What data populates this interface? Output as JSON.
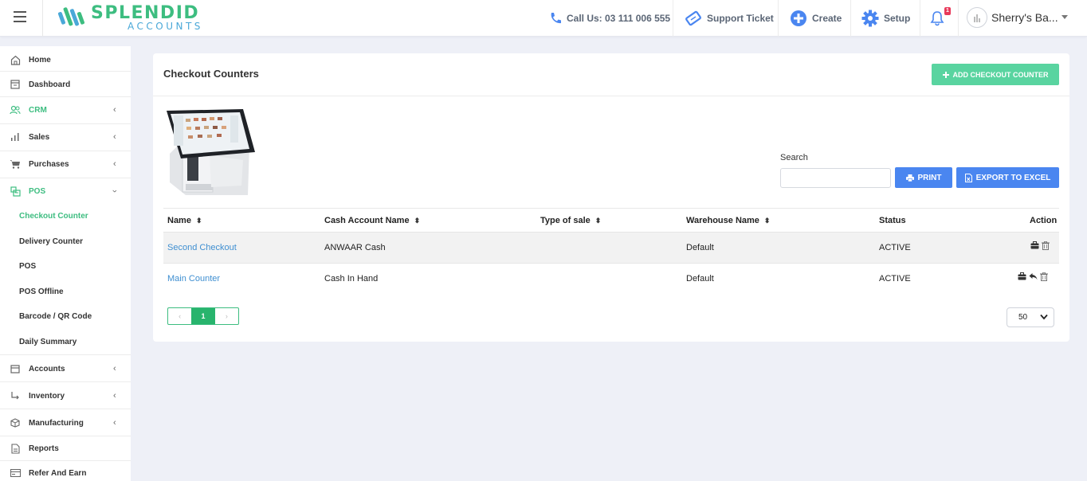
{
  "brand": {
    "name": "SPLENDID",
    "sub": "ACCOUNTS"
  },
  "header": {
    "call_label": "Call Us: 03 111 006 555",
    "support_label": "Support Ticket",
    "create_label": "Create",
    "setup_label": "Setup",
    "notification_count": "1",
    "user_name": "Sherry's Ba..."
  },
  "sidebar": {
    "items": [
      {
        "label": "Home",
        "icon": "home-icon"
      },
      {
        "label": "Dashboard",
        "icon": "dashboard-icon"
      },
      {
        "label": "CRM",
        "icon": "users-icon"
      },
      {
        "label": "Sales",
        "icon": "bar-chart-icon"
      },
      {
        "label": "Purchases",
        "icon": "cart-icon"
      },
      {
        "label": "POS",
        "icon": "pos-icon"
      },
      {
        "label": "Accounts",
        "icon": "calendar-icon"
      },
      {
        "label": "Inventory",
        "icon": "arrow-icon"
      },
      {
        "label": "Manufacturing",
        "icon": "box-icon"
      },
      {
        "label": "Reports",
        "icon": "report-icon"
      },
      {
        "label": "Refer And Earn",
        "icon": "card-icon"
      }
    ],
    "pos_sub": [
      "Checkout Counter",
      "Delivery Counter",
      "POS",
      "POS Offline",
      "Barcode / QR Code",
      "Daily Summary"
    ]
  },
  "page": {
    "title": "Checkout Counters",
    "add_button": "ADD CHECKOUT COUNTER",
    "search_label": "Search",
    "print_button": "PRINT",
    "excel_button": "EXPORT TO EXCEL"
  },
  "table": {
    "headers": [
      "Name",
      "Cash Account Name",
      "Type of sale",
      "Warehouse Name",
      "Status",
      "Action"
    ],
    "rows": [
      {
        "name": "Second Checkout",
        "cash_account": "ANWAAR Cash",
        "type_of_sale": "",
        "warehouse": "Default",
        "status": "ACTIVE"
      },
      {
        "name": "Main Counter",
        "cash_account": "Cash In Hand",
        "type_of_sale": "",
        "warehouse": "Default",
        "status": "ACTIVE"
      }
    ]
  },
  "pagination": {
    "prev": "‹",
    "current": "1",
    "next": "›",
    "page_size": "50"
  },
  "colors": {
    "brand_green": "#3dbd80",
    "primary_blue": "#4a86f0",
    "link_blue": "#3f8fd1",
    "add_green": "#59d4a0"
  }
}
